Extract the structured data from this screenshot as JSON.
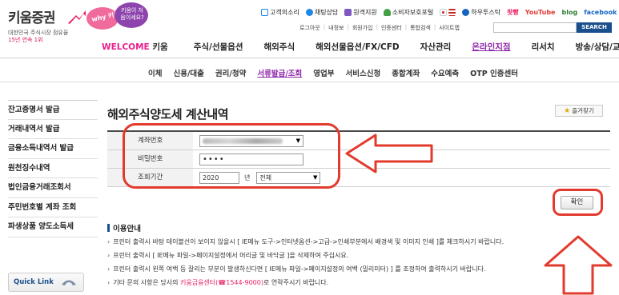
{
  "header": {
    "logo_name": "키움증권",
    "logo_sub1": "대한민국 주식시장 점유율",
    "logo_sub2": "15년 연속 1위",
    "bubble_pink": "why 키움?",
    "bubble_purple": "키움이 처음이세요?",
    "util_links": [
      "고객의소리",
      "채팅상담",
      "원격지원",
      "소비자보호포털",
      "하우투스탁",
      "팟빵",
      "YouTube",
      "blog",
      "facebook"
    ],
    "login_links": [
      "로그아웃",
      "내정보",
      "회원가입",
      "인증센터",
      "통합검색",
      "사이트맵"
    ],
    "search_button": "SEARCH"
  },
  "gnb": {
    "welcome_prefix": "WELCOME",
    "welcome_suffix": "키움",
    "items": [
      "주식/선물옵션",
      "해외주식",
      "해외선물옵션/FX/CFD",
      "자산관리",
      "온라인지점",
      "리서치",
      "방송/상담/교육"
    ],
    "active": "온라인지점"
  },
  "lnb": {
    "items": [
      "이체",
      "신용/대출",
      "권리/청약",
      "서류발급/조회",
      "영업부",
      "서비스신청",
      "종합계좌",
      "수요예측",
      "OTP 인증센터"
    ],
    "active": "서류발급/조회"
  },
  "sidebar": {
    "items": [
      "잔고증명서 발급",
      "거래내역서 발급",
      "금융소득내역서 발급",
      "원천징수내역",
      "법인금융거래조회서",
      "주민번호별 계좌 조회",
      "파생상품 양도소득세"
    ],
    "quick_link": "Quick Link"
  },
  "main": {
    "title": "해외주식양도세 계산내역",
    "favorite_label": "즐겨찾기",
    "form": {
      "account_label": "계좌번호",
      "password_label": "비밀번호",
      "password_value": "••••",
      "period_label": "조회기간",
      "year_value": "2020",
      "year_unit": "년",
      "period_value": "전체"
    },
    "confirm_button": "확인",
    "guide_title": "이용안내",
    "guide_items": [
      "프린터 출력시 바탕 테이블선이 보이지 않을시 [ IE메뉴 도구->인터넷옵션->고급->인쇄부분에서 배경색 및 이미지 인쇄 ]를 체크하시기 바랍니다.",
      "프린터 출력시 [ IE메뉴 파일->페이지설정에서 머리글 및 바닥글 ]을 삭제하여 주십시요.",
      "프린터 출력시 왼쪽 여백 등 잘리는 부분이 발생하신다면 [ IE메뉴 파일->페이지설정의 여백 (밀리미터) ] 를 조정하여 출력하시기 바랍니다."
    ],
    "guide_last_prefix": "기타 문의 사항은 당사의",
    "guide_last_link": "키움금융센터(☎1544-9000)",
    "guide_last_suffix": "로 연락주시기 바랍니다."
  },
  "colors": {
    "accent_pink": "#e91e63",
    "accent_purple": "#8e24aa",
    "highlight_red": "#e23b2e",
    "brand_blue": "#1a4f8b"
  }
}
